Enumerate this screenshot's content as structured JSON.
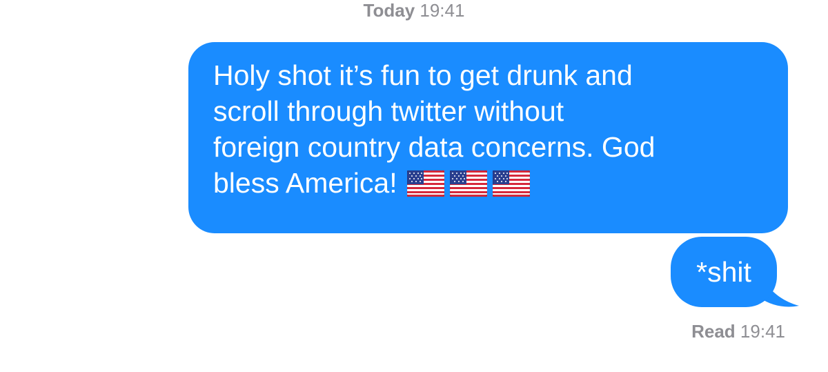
{
  "conversation": {
    "timestamp": {
      "day": "Today",
      "time": "19:41"
    },
    "messages": [
      {
        "lines": [
          "Holy shot it’s fun to get drunk and",
          "scroll through twitter without",
          "foreign country data concerns. God",
          "bless America!"
        ],
        "emoji": [
          "us-flag",
          "us-flag",
          "us-flag"
        ],
        "sender": "me"
      },
      {
        "text": "*shit",
        "sender": "me"
      }
    ],
    "receipt": {
      "status": "Read",
      "time": "19:41"
    }
  },
  "colors": {
    "bubble": "#1a8cff",
    "bubble_text": "#ffffff",
    "meta_text": "#8e8e93"
  }
}
